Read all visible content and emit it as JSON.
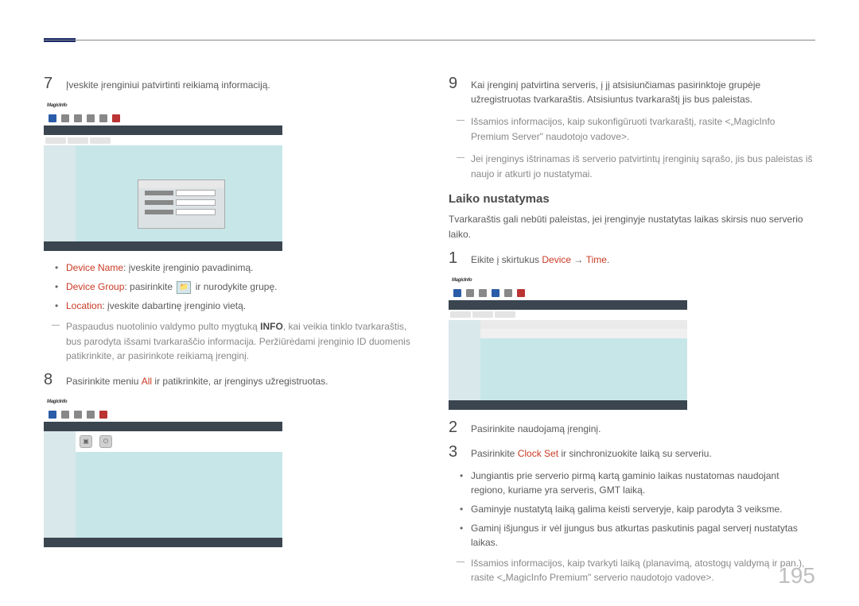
{
  "page_number": "195",
  "left": {
    "step7": {
      "num": "7",
      "text": "Įveskite įrenginiui patvirtinti reikiamą informaciją."
    },
    "screenshot1_logo": "MagicInfo",
    "bullets": [
      {
        "label": "Device Name",
        "rest": ": įveskite įrenginio pavadinimą."
      },
      {
        "label": "Device Group",
        "rest": ": pasirinkite ",
        "tail": " ir nurodykite grupę."
      },
      {
        "label": "Location",
        "rest": ": įveskite dabartinę įrenginio vietą."
      }
    ],
    "dash_note": {
      "pre": "Paspaudus nuotolinio valdymo pulto mygtuką ",
      "bold": "INFO",
      "post": ", kai veikia tinklo tvarkaraštis, bus parodyta išsami tvarkaraščio informacija. Peržiūrėdami įrenginio ID duomenis patikrinkite, ar pasirinkote reikiamą įrenginį."
    },
    "step8": {
      "num": "8",
      "pre": "Pasirinkite meniu ",
      "highlight": "All",
      "post": " ir patikrinkite, ar įrenginys užregistruotas."
    },
    "screenshot2_logo": "MagicInfo"
  },
  "right": {
    "step9": {
      "num": "9",
      "text": "Kai įrenginį patvirtina serveris, į jį atsisiunčiamas pasirinktoje grupėje užregistruotas tvarkaraštis. Atsisiuntus tvarkaraštį jis bus paleistas."
    },
    "dash1": "Išsamios informacijos, kaip sukonfigūruoti tvarkaraštį, rasite <„MagicInfo Premium Server\" naudotojo vadove>.",
    "dash2": "Jei įrenginys ištrinamas iš serverio patvirtintų įrenginių sąrašo, jis bus paleistas iš naujo ir atkurti jo nustatymai.",
    "section_title": "Laiko nustatymas",
    "section_intro": "Tvarkaraštis gali nebūti paleistas, jei įrenginyje nustatytas laikas skirsis nuo serverio laiko.",
    "step1": {
      "num": "1",
      "pre": "Eikite į skirtukus ",
      "h1": "Device",
      "arrow": " → ",
      "h2": "Time",
      "post": "."
    },
    "screenshot3_logo": "MagicInfo",
    "step2": {
      "num": "2",
      "text": "Pasirinkite naudojamą įrenginį."
    },
    "step3": {
      "num": "3",
      "pre": "Pasirinkite ",
      "highlight": "Clock Set",
      "post": " ir sinchronizuokite laiką su serveriu."
    },
    "bullets2": [
      "Jungiantis prie serverio pirmą kartą gaminio laikas nustatomas naudojant regiono, kuriame yra serveris, GMT laiką.",
      "Gaminyje nustatytą laiką galima keisti serveryje, kaip parodyta 3 veiksme.",
      "Gaminį išjungus ir vėl įjungus bus atkurtas paskutinis pagal serverį nustatytas laikas."
    ],
    "dash3": "Išsamios informacijos, kaip tvarkyti laiką (planavimą, atostogų valdymą ir pan.), rasite <„MagicInfo Premium\" serverio naudotojo vadove>."
  }
}
